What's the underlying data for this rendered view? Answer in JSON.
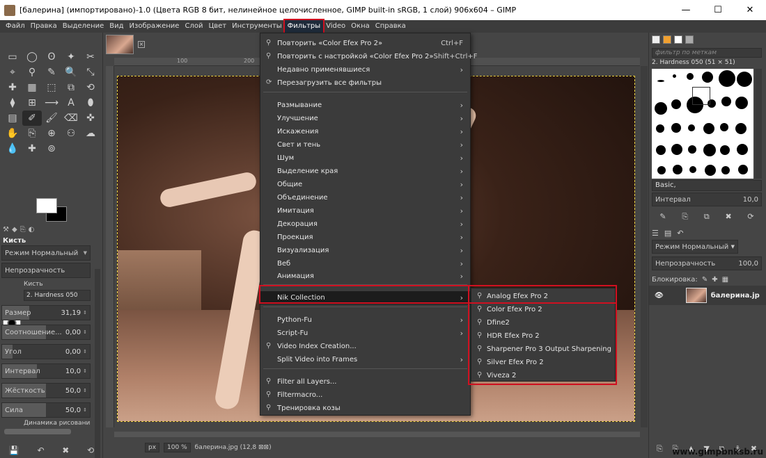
{
  "window": {
    "title": "[балерина] (импортировано)-1.0 (Цвета RGB 8 бит, нелинейное целочисленное, GIMP built-in sRGB, 1 слой) 906x604 – GIMP",
    "minimize": "—",
    "maximize": "☐",
    "close": "✕"
  },
  "menubar": [
    "Файл",
    "Правка",
    "Выделение",
    "Вид",
    "Изображение",
    "Слой",
    "Цвет",
    "Инструменты",
    "Фильтры",
    "Video",
    "Окна",
    "Справка"
  ],
  "toolbox": {
    "tools": [
      "▭",
      "◯",
      "ʘ",
      "✦",
      "✂",
      "⌖",
      "⚲",
      "✎",
      "🔍",
      "⤡",
      "✚",
      "▦",
      "⬚",
      "⧉",
      "⟲",
      "⧫",
      "⊞",
      "⟶",
      "A",
      "⬮",
      "▤",
      "✐",
      "🖌",
      "⌫",
      "✜",
      "✋",
      "⎘",
      "⊕",
      "⚇",
      "☁",
      "💧",
      "✚",
      "⊚"
    ],
    "tabs": [
      "⚒",
      "◆",
      "⎘",
      "◐"
    ],
    "options_title": "Кисть",
    "mode_label": "Режим",
    "mode_value": "Нормальный",
    "opacity_label": "Непрозрачность",
    "brush_label": "Кисть",
    "brush_value": "2. Hardness 050",
    "size_label": "Размер",
    "size_value": "31,19",
    "size_level": 0.31,
    "ratio_label": "Соотношение...",
    "ratio_value": "0,00",
    "ratio_level": 0.5,
    "angle_label": "Угол",
    "angle_value": "0,00",
    "angle_level": 0.12,
    "interval_label": "Интервал",
    "interval_value": "10,0",
    "interval_level": 0.4,
    "hardness_label": "Жёсткость",
    "hardness_value": "50,0",
    "hardness_level": 0.5,
    "force_label": "Сила",
    "force_value": "50,0",
    "force_level": 0.5,
    "dynamics_label": "Динамика рисовани",
    "bottom_icons": [
      "💾",
      "↶",
      "✖",
      "⟲"
    ]
  },
  "canvas": {
    "ruler_labels": [
      "100",
      "200"
    ],
    "status_unit": "px",
    "status_zoom": "100 %",
    "status_file": "балерина.jpg (12,8 ⊠⊠)"
  },
  "filters_menu": {
    "items": [
      {
        "label": "Повторить «Color Efex Pro 2»",
        "shortcut": "Ctrl+F",
        "icon": "⚲"
      },
      {
        "label": "Повторить с настройкой «Color Efex Pro 2»",
        "shortcut": "Shift+Ctrl+F",
        "icon": "⚲"
      },
      {
        "label": "Недавно применявшиеся",
        "arrow": "›"
      },
      {
        "label": "Перезагрузить все фильтры",
        "icon": "⟳"
      },
      {
        "label": "Размывание",
        "arrow": "›"
      },
      {
        "label": "Улучшение",
        "arrow": "›"
      },
      {
        "label": "Искажения",
        "arrow": "›"
      },
      {
        "label": "Свет и тень",
        "arrow": "›"
      },
      {
        "label": "Шум",
        "arrow": "›"
      },
      {
        "label": "Выделение края",
        "arrow": "›"
      },
      {
        "label": "Общие",
        "arrow": "›"
      },
      {
        "label": "Объединение",
        "arrow": "›"
      },
      {
        "label": "Имитация",
        "arrow": "›"
      },
      {
        "label": "Декорация",
        "arrow": "›"
      },
      {
        "label": "Проекция",
        "arrow": "›"
      },
      {
        "label": "Визуализация",
        "arrow": "›"
      },
      {
        "label": "Веб",
        "arrow": "›"
      },
      {
        "label": "Анимация",
        "arrow": "›"
      },
      {
        "label": "Nik Collection",
        "arrow": "›"
      },
      {
        "label": "Python-Fu",
        "arrow": "›"
      },
      {
        "label": "Script-Fu",
        "arrow": "›"
      },
      {
        "label": "Video Index Creation...",
        "icon": "⚲"
      },
      {
        "label": "Split Video into Frames",
        "arrow": "›"
      },
      {
        "label": "Filter all Layers...",
        "icon": "⚲"
      },
      {
        "label": "Filtermacro...",
        "icon": "⚲"
      },
      {
        "label": "Тренировка козы",
        "icon": "⚲"
      }
    ]
  },
  "nik_menu": {
    "items": [
      "Analog Efex Pro 2",
      "Color Efex Pro 2",
      "Dfine2",
      "HDR Efex Pro 2",
      "Sharpener Pro 3 Output Sharpening",
      "Silver Efex Pro 2",
      "Viveza 2"
    ],
    "icon": "⚲"
  },
  "right_dock": {
    "filter_placeholder": "фильтр по меткам",
    "brush_name": "2. Hardness 050 (51 × 51)",
    "brush_set": "Basic,",
    "interval_label": "Интервал",
    "interval_value": "10,0",
    "brush_icons": [
      "✎",
      "⎘",
      "⧉",
      "✖",
      "⟳"
    ],
    "layer_tabs": [
      "☰",
      "▤",
      "↶"
    ],
    "mode_label": "Режим",
    "mode_value": "Нормальный",
    "opacity_label": "Непрозрачность",
    "opacity_value": "100,0",
    "lock_label": "Блокировка:",
    "lock_icons": [
      "✎",
      "✚",
      "▦"
    ],
    "layer_name": "балерина.jp",
    "layer_visibility": "👁",
    "bottom_icons": [
      "⎘",
      "⎘",
      "▲",
      "▼",
      "⧉",
      "⚓",
      "✖"
    ]
  },
  "watermark": "www.gimpbnksb.ru"
}
